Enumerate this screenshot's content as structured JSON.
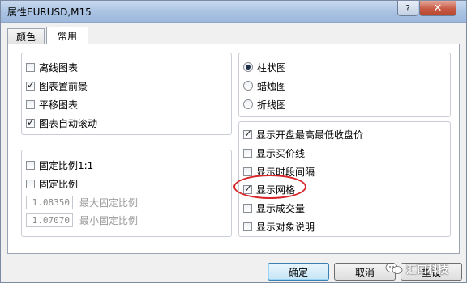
{
  "window": {
    "title": "属性EURUSD,M15",
    "help_label": "?",
    "close_label": "✕"
  },
  "tabs": [
    {
      "label": "颜色",
      "active": false
    },
    {
      "label": "常用",
      "active": true
    }
  ],
  "left_group1": {
    "items": [
      {
        "label": "离线图表",
        "checked": false
      },
      {
        "label": "图表置前景",
        "checked": true
      },
      {
        "label": "平移图表",
        "checked": false
      },
      {
        "label": "图表自动滚动",
        "checked": true
      }
    ]
  },
  "left_group2": {
    "items": [
      {
        "label": "固定比例1:1",
        "checked": false
      },
      {
        "label": "固定比例",
        "checked": false
      }
    ],
    "max_scale": {
      "value": "1.08350",
      "label": "最大固定比例"
    },
    "min_scale": {
      "value": "1.07070",
      "label": "最小固定比例"
    }
  },
  "chart_type": {
    "options": [
      {
        "label": "柱状图",
        "selected": true
      },
      {
        "label": "蜡烛图",
        "selected": false
      },
      {
        "label": "折线图",
        "selected": false
      }
    ]
  },
  "display_options": {
    "items": [
      {
        "label": "显示开盘最高最低收盘价",
        "checked": true
      },
      {
        "label": "显示买价线",
        "checked": false
      },
      {
        "label": "显示时段间隔",
        "checked": false
      },
      {
        "label": "显示网格",
        "checked": true
      },
      {
        "label": "显示成交量",
        "checked": false
      },
      {
        "label": "显示对象说明",
        "checked": false
      }
    ]
  },
  "buttons": {
    "ok": "确定",
    "cancel": "取消",
    "reset": "重设"
  },
  "watermark": {
    "text": "汇口科技"
  },
  "colors": {
    "highlight": "#d8262a",
    "ok_border": "#3c7fb1"
  }
}
